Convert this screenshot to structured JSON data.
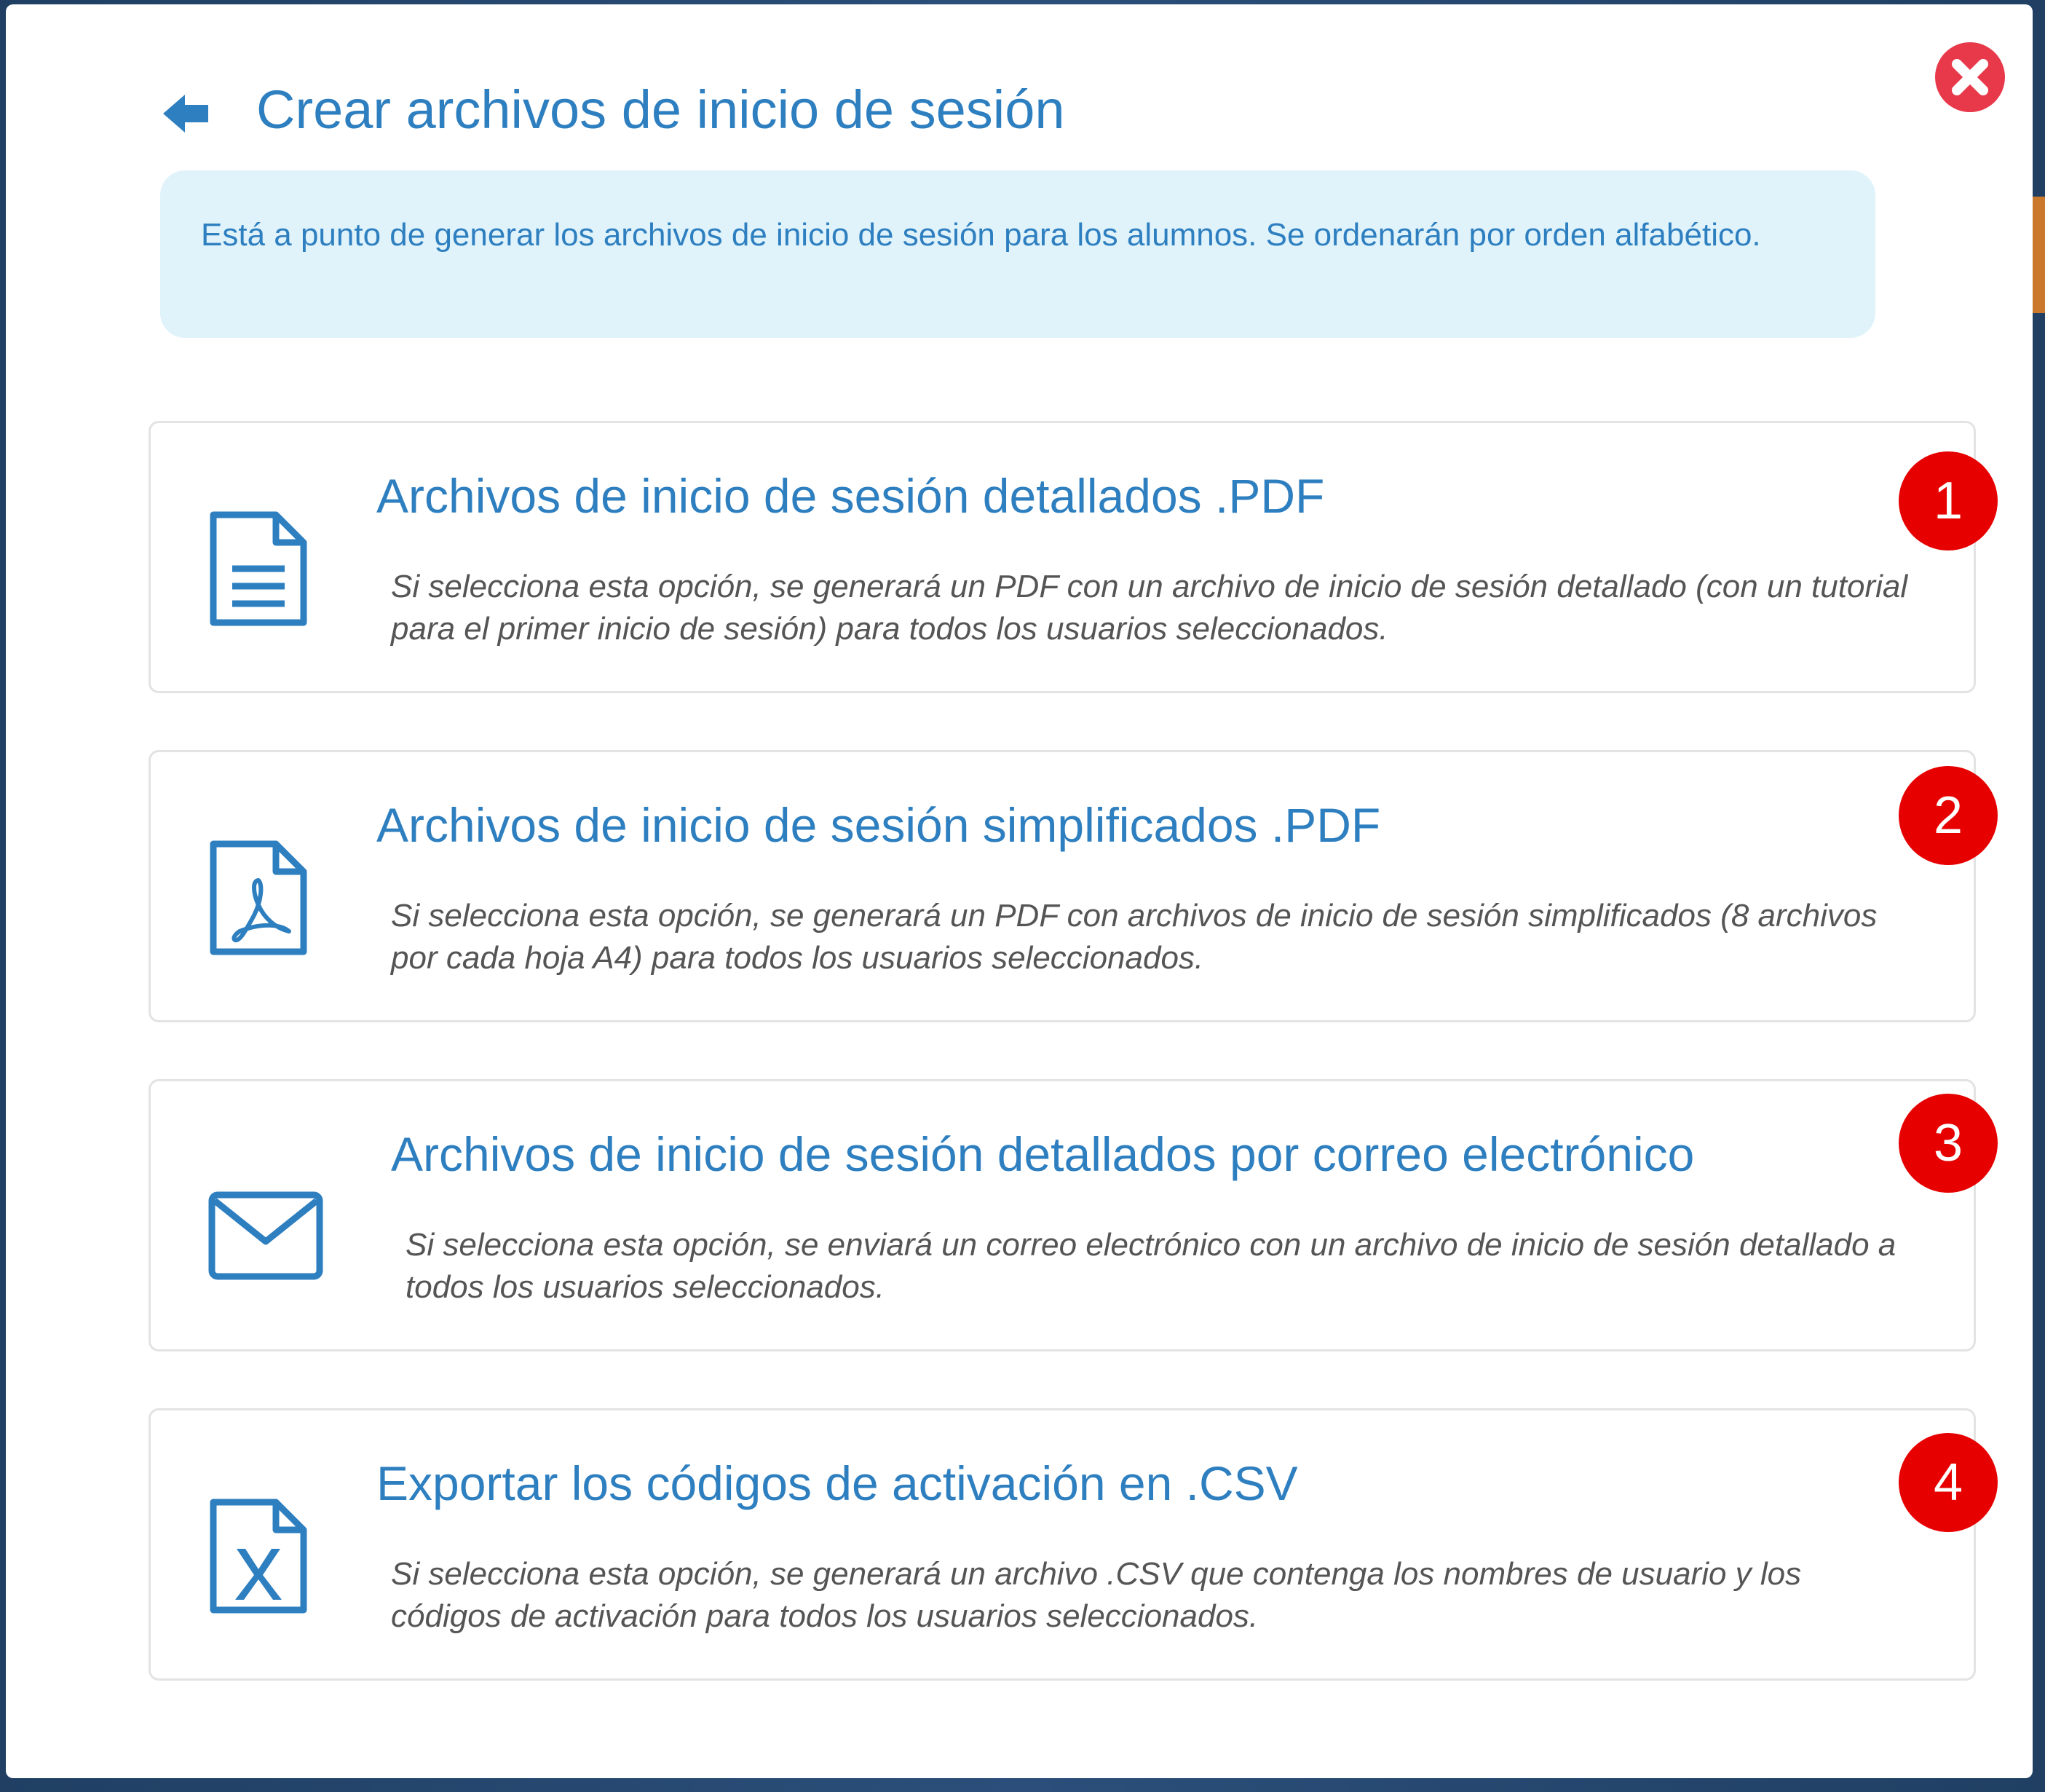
{
  "dialog": {
    "title": "Crear archivos de inicio de sesión",
    "info": "Está a punto de generar los archivos de inicio de sesión para los alumnos. Se ordenarán por orden alfabético."
  },
  "colors": {
    "accent": "#2e7fc0",
    "info_bg": "#e0f3fb",
    "close": "#e8394b",
    "badge": "#e60000"
  },
  "options": [
    {
      "title": "Archivos de inicio de sesión detallados .PDF",
      "description": "Si selecciona esta opción, se generará un PDF con un archivo de inicio de sesión detallado (con un tutorial para el primer inicio de sesión) para todos los usuarios seleccionados.",
      "icon": "document-icon",
      "badge": "1"
    },
    {
      "title": "Archivos de inicio de sesión simplificados .PDF",
      "description": "Si selecciona esta opción, se generará un PDF con archivos de inicio de sesión simplificados (8 archivos por cada hoja A4) para todos los usuarios seleccionados.",
      "icon": "pdf-file-icon",
      "badge": "2"
    },
    {
      "title": "Archivos de inicio de sesión detallados por correo electrónico",
      "description": "Si selecciona esta opción, se enviará un correo electrónico con un archivo de inicio de sesión detallado a todos los usuarios seleccionados.",
      "icon": "envelope-icon",
      "badge": "3"
    },
    {
      "title": "Exportar los códigos de activación en .CSV",
      "description": "Si selecciona esta opción, se generará un archivo .CSV que contenga los nombres de usuario y los códigos de activación para todos los usuarios seleccionados.",
      "icon": "excel-file-icon",
      "badge": "4"
    }
  ]
}
